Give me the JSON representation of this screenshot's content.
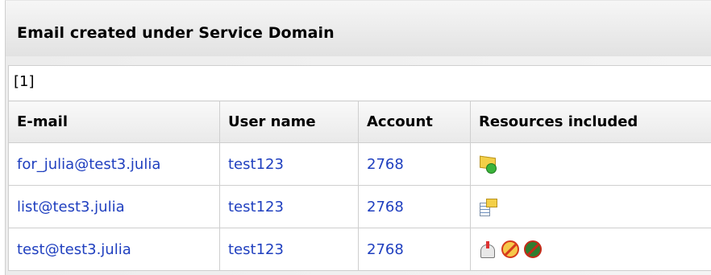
{
  "panel": {
    "title": "Email created under Service Domain"
  },
  "pager": {
    "text": "[1]"
  },
  "table": {
    "headers": [
      "E-mail",
      "User name",
      "Account",
      "Resources included"
    ],
    "rows": [
      {
        "email": "for_julia@test3.julia",
        "user": "test123",
        "account": "2768",
        "resources": [
          "mail-forward-icon"
        ]
      },
      {
        "email": "list@test3.julia",
        "user": "test123",
        "account": "2768",
        "resources": [
          "mailing-list-icon"
        ]
      },
      {
        "email": "test@test3.julia",
        "user": "test123",
        "account": "2768",
        "resources": [
          "mailbox-icon",
          "mail-disabled-icon",
          "antivirus-disabled-icon"
        ]
      }
    ]
  }
}
